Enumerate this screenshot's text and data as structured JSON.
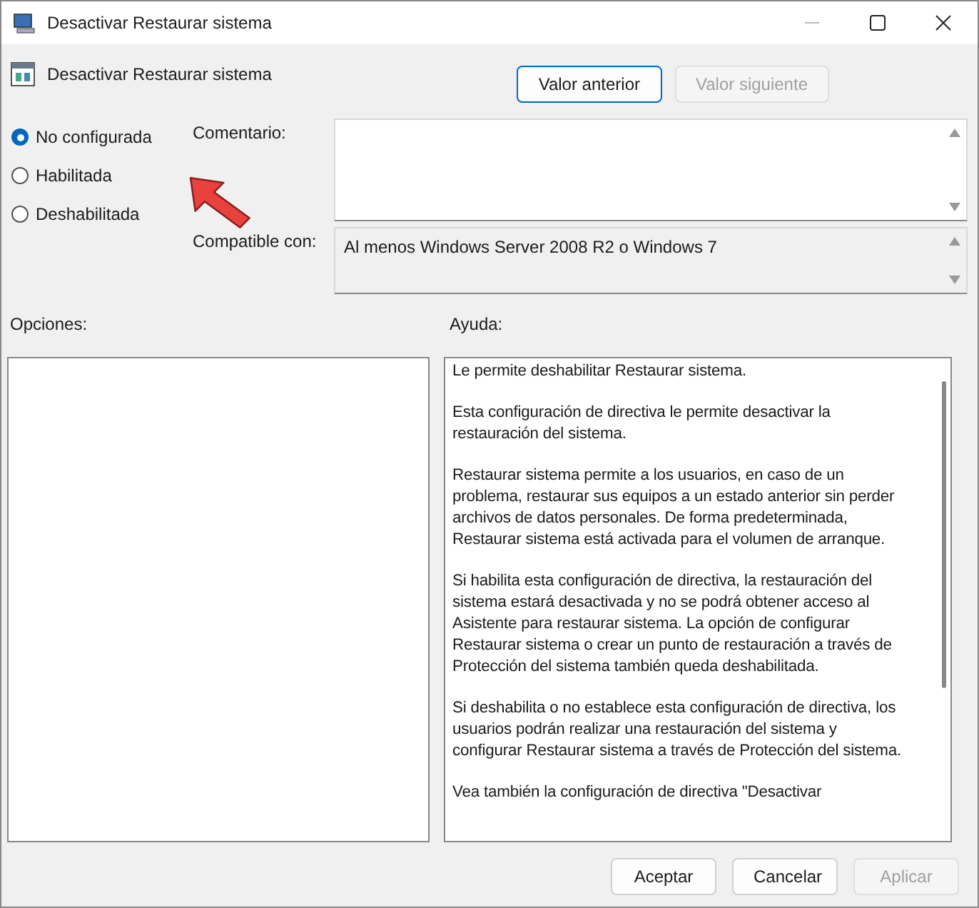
{
  "window": {
    "title": "Desactivar Restaurar sistema"
  },
  "policy_title": "Desactivar Restaurar sistema",
  "nav_buttons": [
    {
      "label": "Valor anterior",
      "disabled": false,
      "focused": true
    },
    {
      "label": "Valor siguiente",
      "disabled": true,
      "focused": false
    }
  ],
  "options_radio": [
    {
      "label": "No configurada",
      "selected": true
    },
    {
      "label": "Habilitada",
      "selected": false
    },
    {
      "label": "Deshabilitada",
      "selected": false
    }
  ],
  "comment": {
    "label": "Comentario:"
  },
  "supported": {
    "label": "Compatible con:",
    "value": "Al menos Windows Server 2008 R2 o Windows 7"
  },
  "options_label": "Opciones:",
  "help_label": "Ayuda:",
  "help_paragraphs": [
    [
      "Le permite deshabilitar Restaurar sistema."
    ],
    [
      "Esta configuración de directiva le permite desactivar la",
      "restauración del sistema."
    ],
    [
      "Restaurar sistema permite a los usuarios, en caso de un",
      "problema, restaurar sus equipos a un estado anterior sin perder",
      "archivos de datos personales. De forma predeterminada,",
      "Restaurar sistema está activada para el volumen de arranque."
    ],
    [
      "Si habilita esta configuración de directiva, la restauración del",
      "sistema estará desactivada y no se podrá obtener acceso al",
      "Asistente para restaurar sistema. La opción de configurar",
      "Restaurar sistema o crear un punto de restauración a través de",
      "Protección del sistema también queda deshabilitada."
    ],
    [
      "Si deshabilita o no establece esta configuración de directiva, los",
      "usuarios podrán realizar una restauración del sistema y",
      "configurar Restaurar sistema a través de Protección del sistema."
    ],
    [
      "Vea también la configuración de directiva \"Desactivar"
    ]
  ],
  "footer_buttons": [
    {
      "label": "Aceptar",
      "disabled": false
    },
    {
      "label": "Cancelar",
      "disabled": false
    },
    {
      "label": "Aplicar",
      "disabled": true
    }
  ]
}
